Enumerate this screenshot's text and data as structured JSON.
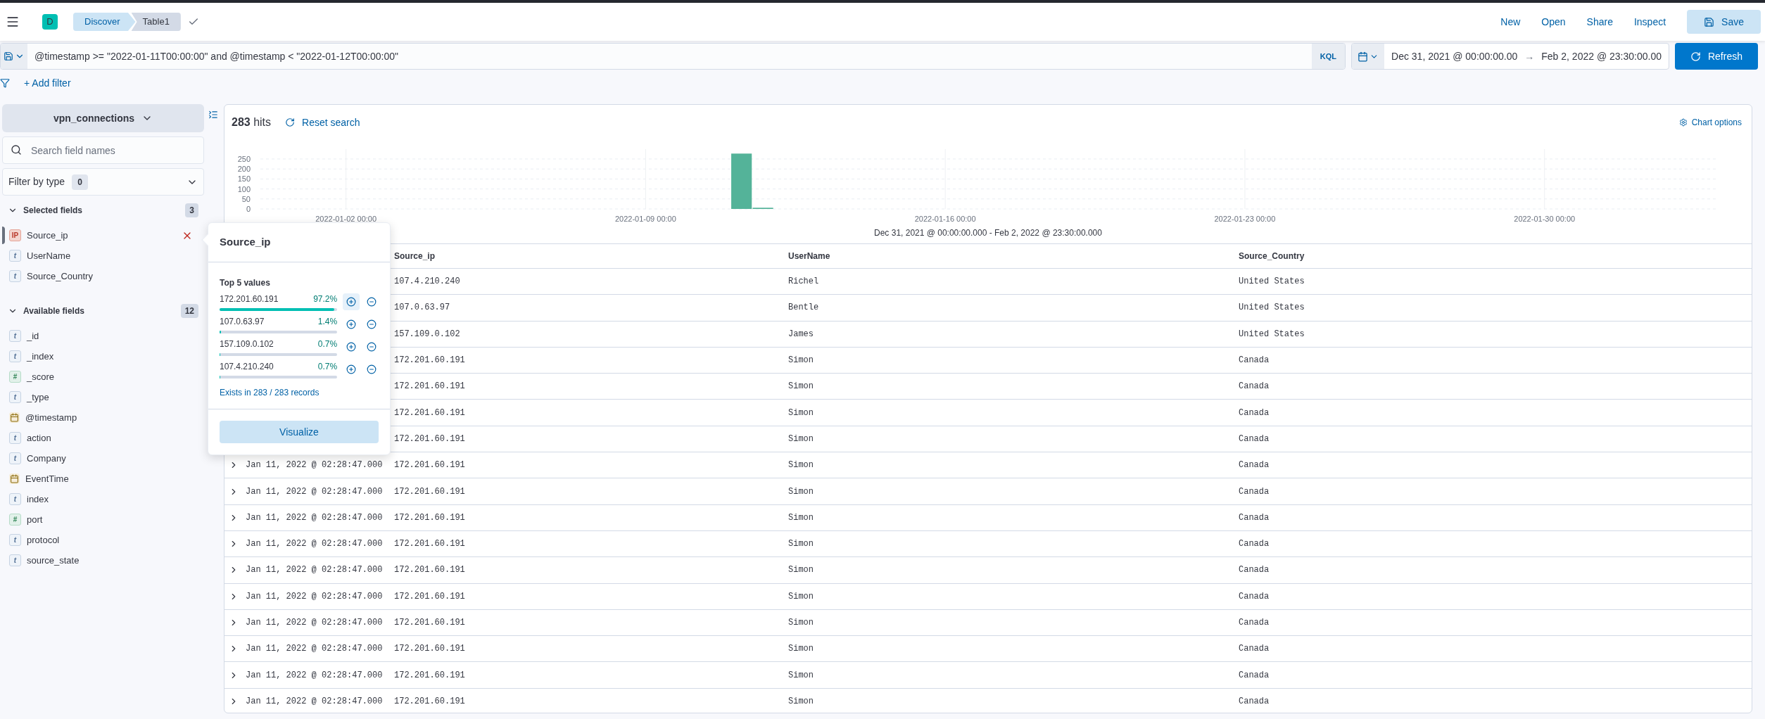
{
  "header": {
    "avatar": "D",
    "breadcrumbs": [
      {
        "label": "Discover",
        "selected": true
      },
      {
        "label": "Table1",
        "selected": false
      }
    ],
    "links": [
      "New",
      "Open",
      "Share",
      "Inspect"
    ],
    "save_button": "Save"
  },
  "query_bar": {
    "query": "@timestamp >= \"2022-01-11T00:00:00\" and @timestamp < \"2022-01-12T00:00:00\"",
    "language": "KQL",
    "start": "Dec 31, 2021 @ 00:00:00.00",
    "arrow": "→",
    "end": "Feb 2, 2022 @ 23:30:00.00",
    "refresh_button": "Refresh"
  },
  "add_filter": "+ Add filter",
  "sidebar": {
    "index_pattern": "vpn_connections",
    "search": {
      "placeholder": "Search field names"
    },
    "filter_by_type": {
      "label": "Filter by type",
      "count": "0"
    },
    "selected_fields": {
      "title": "Selected fields",
      "count": "3",
      "expanded": true,
      "items": [
        {
          "name": "Source_ip",
          "kind": "ip",
          "token": "IP",
          "active": true
        },
        {
          "name": "UserName",
          "kind": "string",
          "token": "t",
          "active": false
        },
        {
          "name": "Source_Country",
          "kind": "string",
          "token": "t",
          "active": false
        }
      ]
    },
    "available_fields": {
      "title": "Available fields",
      "count": "12",
      "expanded": true,
      "items": [
        {
          "name": "_id",
          "kind": "string",
          "token": "t"
        },
        {
          "name": "_index",
          "kind": "string",
          "token": "t"
        },
        {
          "name": "_score",
          "kind": "number",
          "token": "#"
        },
        {
          "name": "_type",
          "kind": "string",
          "token": "t"
        },
        {
          "name": "@timestamp",
          "kind": "date"
        },
        {
          "name": "action",
          "kind": "string",
          "token": "t"
        },
        {
          "name": "Company",
          "kind": "string",
          "token": "t"
        },
        {
          "name": "EventTime",
          "kind": "date"
        },
        {
          "name": "index",
          "kind": "string",
          "token": "t"
        },
        {
          "name": "port",
          "kind": "number",
          "token": "#"
        },
        {
          "name": "protocol",
          "kind": "string",
          "token": "t"
        },
        {
          "name": "source_state",
          "kind": "string",
          "token": "t"
        }
      ]
    }
  },
  "popover": {
    "title": "Source_ip",
    "subtitle": "Top 5 values",
    "values": [
      {
        "value": "172.201.60.191",
        "percent": "97.2%",
        "level": 0.972,
        "highlighted": true
      },
      {
        "value": "107.0.63.97",
        "percent": "1.4%",
        "level": 0.014,
        "highlighted": false
      },
      {
        "value": "157.109.0.102",
        "percent": "0.7%",
        "level": 0.007,
        "highlighted": false
      },
      {
        "value": "107.4.210.240",
        "percent": "0.7%",
        "level": 0.007,
        "highlighted": false
      }
    ],
    "exists": "Exists in 283 / 283 records",
    "visualize_button": "Visualize"
  },
  "results": {
    "hits": "**283** hits",
    "reset_search": "Reset search",
    "chart_options": "Chart options",
    "chart_data": {
      "type": "bar",
      "grid": true,
      "ylim": [
        0,
        283
      ],
      "yticks": [
        0,
        50,
        100,
        150,
        200,
        250
      ],
      "categories": [
        null,
        null,
        null,
        null,
        "2022-01-02 00:00",
        null,
        null,
        null,
        null,
        null,
        null,
        null,
        null,
        null,
        null,
        null,
        null,
        null,
        "2022-01-09 00:00",
        null,
        null,
        null,
        null,
        null,
        null,
        null,
        null,
        null,
        null,
        null,
        null,
        null,
        "2022-01-16 00:00",
        null,
        null,
        null,
        null,
        null,
        null,
        null,
        null,
        null,
        null,
        null,
        null,
        null,
        "2022-01-23 00:00",
        null,
        null,
        null,
        null,
        null,
        null,
        null,
        null,
        null,
        null,
        null,
        null,
        null,
        "2022-01-30 00:00",
        null,
        null,
        null,
        null,
        null,
        null,
        null
      ],
      "values": [
        0,
        0,
        0,
        0,
        0,
        0,
        0,
        0,
        0,
        0,
        0,
        0,
        0,
        0,
        0,
        0,
        0,
        0,
        0,
        0,
        0,
        0,
        277,
        6,
        0,
        0,
        0,
        0,
        0,
        0,
        0,
        0,
        0,
        0,
        0,
        0,
        0,
        0,
        0,
        0,
        0,
        0,
        0,
        0,
        0,
        0,
        0,
        0,
        0,
        0,
        0,
        0,
        0,
        0,
        0,
        0,
        0,
        0,
        0,
        0,
        0,
        0,
        0,
        0,
        0,
        0,
        0,
        0
      ]
    },
    "range": "Dec 31, 2021 @ 00:00:00.000 - Feb 2, 2022 @ 23:30:00.000"
  },
  "table": {
    "columns": [
      "Source_ip",
      "UserName",
      "Source_Country"
    ],
    "rows": [
      {
        "source_ip": "107.4.210.240",
        "user_name": "Richel",
        "source_country": "United States"
      },
      {
        "source_ip": "107.0.63.97",
        "user_name": "Bentle",
        "source_country": "United States"
      },
      {
        "source_ip": "157.109.0.102",
        "user_name": "James",
        "source_country": "United States"
      },
      {
        "source_ip": "172.201.60.191",
        "user_name": "Simon",
        "source_country": "Canada"
      },
      {
        "source_ip": "172.201.60.191",
        "user_name": "Simon",
        "source_country": "Canada"
      },
      {
        "source_ip": "172.201.60.191",
        "user_name": "Simon",
        "source_country": "Canada"
      },
      {
        "source_ip": "172.201.60.191",
        "user_name": "Simon",
        "source_country": "Canada"
      },
      {
        "time": "Jan 11, 2022 @ 02:28:47.000",
        "source_ip": "172.201.60.191",
        "user_name": "Simon",
        "source_country": "Canada"
      },
      {
        "time": "Jan 11, 2022 @ 02:28:47.000",
        "source_ip": "172.201.60.191",
        "user_name": "Simon",
        "source_country": "Canada"
      },
      {
        "time": "Jan 11, 2022 @ 02:28:47.000",
        "source_ip": "172.201.60.191",
        "user_name": "Simon",
        "source_country": "Canada"
      },
      {
        "time": "Jan 11, 2022 @ 02:28:47.000",
        "source_ip": "172.201.60.191",
        "user_name": "Simon",
        "source_country": "Canada"
      },
      {
        "time": "Jan 11, 2022 @ 02:28:47.000",
        "source_ip": "172.201.60.191",
        "user_name": "Simon",
        "source_country": "Canada"
      },
      {
        "time": "Jan 11, 2022 @ 02:28:47.000",
        "source_ip": "172.201.60.191",
        "user_name": "Simon",
        "source_country": "Canada"
      },
      {
        "time": "Jan 11, 2022 @ 02:28:47.000",
        "source_ip": "172.201.60.191",
        "user_name": "Simon",
        "source_country": "Canada"
      },
      {
        "time": "Jan 11, 2022 @ 02:28:47.000",
        "source_ip": "172.201.60.191",
        "user_name": "Simon",
        "source_country": "Canada"
      },
      {
        "time": "Jan 11, 2022 @ 02:28:47.000",
        "source_ip": "172.201.60.191",
        "user_name": "Simon",
        "source_country": "Canada"
      },
      {
        "time": "Jan 11, 2022 @ 02:28:47.000",
        "source_ip": "172.201.60.191",
        "user_name": "Simon",
        "source_country": "Canada"
      }
    ]
  }
}
